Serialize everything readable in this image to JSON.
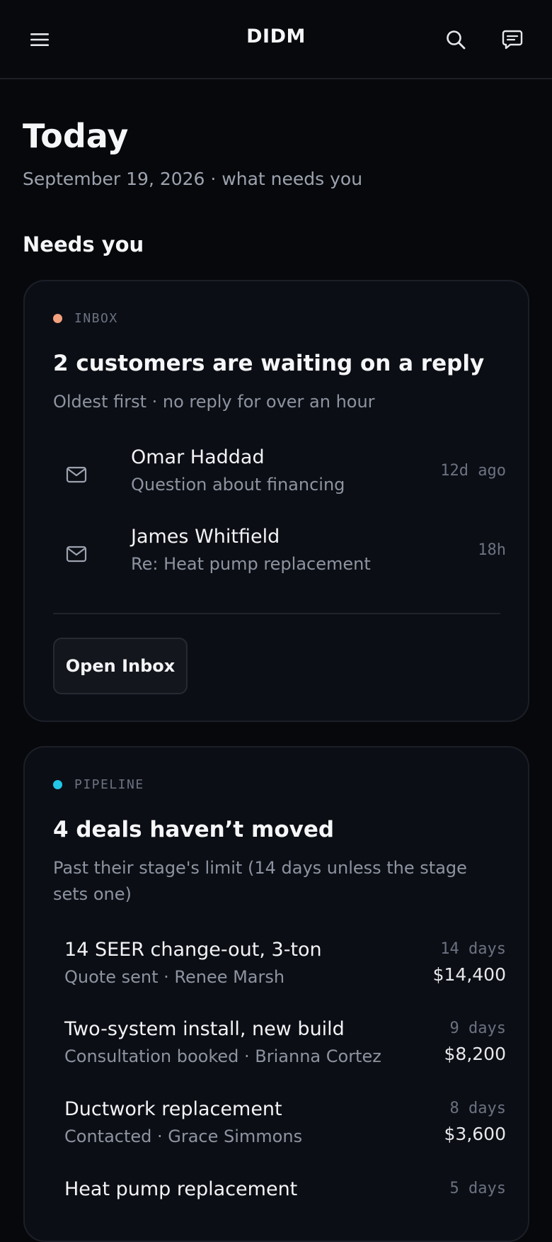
{
  "header": {
    "brand": "DIDM",
    "icons": {
      "menu": "hamburger-icon",
      "search": "search-icon",
      "messages": "chat-icon"
    }
  },
  "page": {
    "title": "Today",
    "subtitle": "September 19, 2026 · what needs you",
    "section_title": "Needs you"
  },
  "inbox_card": {
    "tag": "INBOX",
    "tag_color": "#f3a17f",
    "title": "2 customers are waiting on a reply",
    "subtitle": "Oldest first · no reply for over an hour",
    "messages": [
      {
        "name": "Omar Haddad",
        "subject": "Question about financing",
        "time": "12d ago"
      },
      {
        "name": "James Whitfield",
        "subject": "Re: Heat pump replacement",
        "time": "18h"
      }
    ],
    "button_label": "Open Inbox"
  },
  "pipeline_card": {
    "tag": "PIPELINE",
    "tag_color": "#22c7e8",
    "title": "4 deals haven’t moved",
    "subtitle": "Past their stage's limit (14 days unless the stage sets one)",
    "deals": [
      {
        "name": "14 SEER change-out, 3-ton",
        "meta": "Quote sent · Renee Marsh",
        "days": "14 days",
        "amount": "$14,400"
      },
      {
        "name": "Two-system install, new build",
        "meta": "Consultation booked · Brianna Cortez",
        "days": "9 days",
        "amount": "$8,200"
      },
      {
        "name": "Ductwork replacement",
        "meta": "Contacted · Grace Simmons",
        "days": "8 days",
        "amount": "$3,600"
      },
      {
        "name": "Heat pump replacement",
        "meta": "",
        "days": "5 days",
        "amount": ""
      }
    ]
  }
}
